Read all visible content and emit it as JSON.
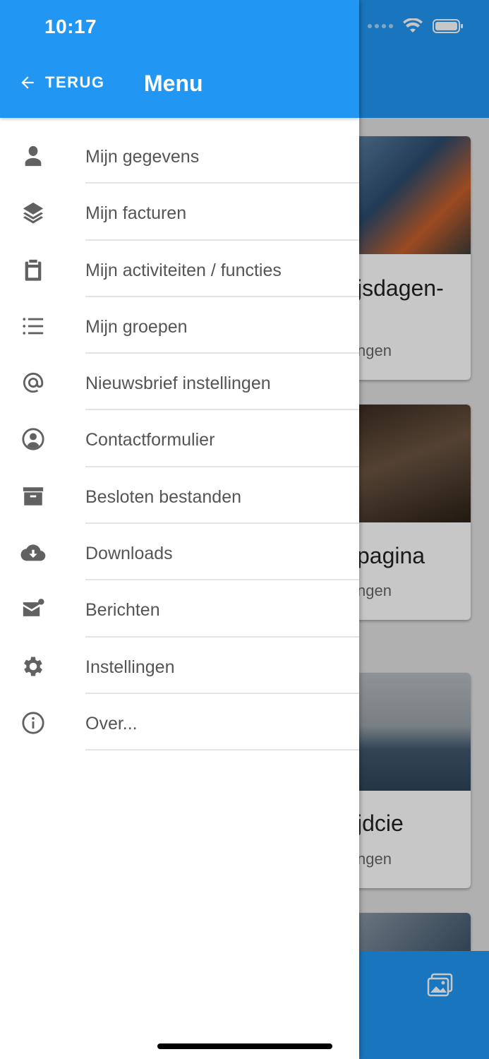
{
  "status_bar": {
    "time": "10:17"
  },
  "header": {
    "back_label": "TERUG",
    "title": "Menu"
  },
  "menu": {
    "items": [
      {
        "label": "Mijn gegevens",
        "icon": "person-icon"
      },
      {
        "label": "Mijn facturen",
        "icon": "layers-icon"
      },
      {
        "label": "Mijn activiteiten / functies",
        "icon": "clipboard-icon"
      },
      {
        "label": "Mijn groepen",
        "icon": "list-icon"
      },
      {
        "label": "Nieuwsbrief instellingen",
        "icon": "at-icon"
      },
      {
        "label": "Contactformulier",
        "icon": "account-circle-icon"
      },
      {
        "label": "Besloten bestanden",
        "icon": "archive-icon"
      },
      {
        "label": "Downloads",
        "icon": "cloud-download-icon"
      },
      {
        "label": "Berichten",
        "icon": "mail-icon"
      },
      {
        "label": "Instellingen",
        "icon": "gear-icon"
      },
      {
        "label": "Over...",
        "icon": "info-icon"
      }
    ]
  },
  "background_cards": [
    {
      "title_fragment": "jsdagen-",
      "subtitle_fragment": "ngen"
    },
    {
      "title_fragment": "pagina",
      "subtitle_fragment": "ngen"
    },
    {
      "title_fragment": "jdcie",
      "subtitle_fragment": "ngen"
    }
  ],
  "colors": {
    "primary": "#2196f3",
    "icon": "#616161",
    "label": "#555555"
  }
}
